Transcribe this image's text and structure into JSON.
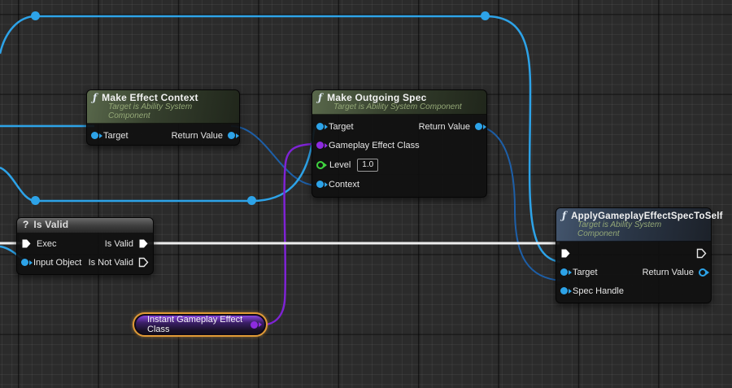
{
  "editor": "unreal-blueprint-graph",
  "colors": {
    "background": "#2b2b2b",
    "wire_object": "#2da3e8",
    "wire_object_dark": "#1d5fa8",
    "wire_exec": "#eeeeee",
    "wire_class": "#7e23d4",
    "pin_object": "#2da3e8",
    "pin_class": "#8d2be0",
    "pin_float": "#3fd43f",
    "selection_outline": "#e09a36",
    "header_function_green": "#59684b",
    "header_function_blue": "#44566e",
    "header_macro_gray": "#6a6a6a"
  },
  "nodes": {
    "make_effect_context": {
      "icon": "ƒ",
      "title": "Make Effect Context",
      "subtitle": "Target is Ability System Component",
      "pins": {
        "target": "Target",
        "return_value": "Return Value"
      }
    },
    "make_outgoing_spec": {
      "icon": "ƒ",
      "title": "Make Outgoing Spec",
      "subtitle": "Target is Ability System Component",
      "pins": {
        "target": "Target",
        "gameplay_effect_class": "Gameplay Effect Class",
        "level": "Level",
        "context": "Context",
        "return_value": "Return Value"
      },
      "level_value": "1.0"
    },
    "is_valid": {
      "icon": "?",
      "title": "Is Valid",
      "pins": {
        "exec": "Exec",
        "input_object": "Input Object",
        "is_valid": "Is Valid",
        "is_not_valid": "Is Not Valid"
      }
    },
    "apply_gameplay_effect_spec_to_self": {
      "icon": "ƒ",
      "title": "ApplyGameplayEffectSpecToSelf",
      "subtitle": "Target is Ability System Component",
      "pins": {
        "target": "Target",
        "spec_handle": "Spec Handle",
        "return_value": "Return Value"
      }
    },
    "instant_gameplay_effect_class": {
      "title": "Instant Gameplay Effect Class",
      "selected": true
    }
  }
}
